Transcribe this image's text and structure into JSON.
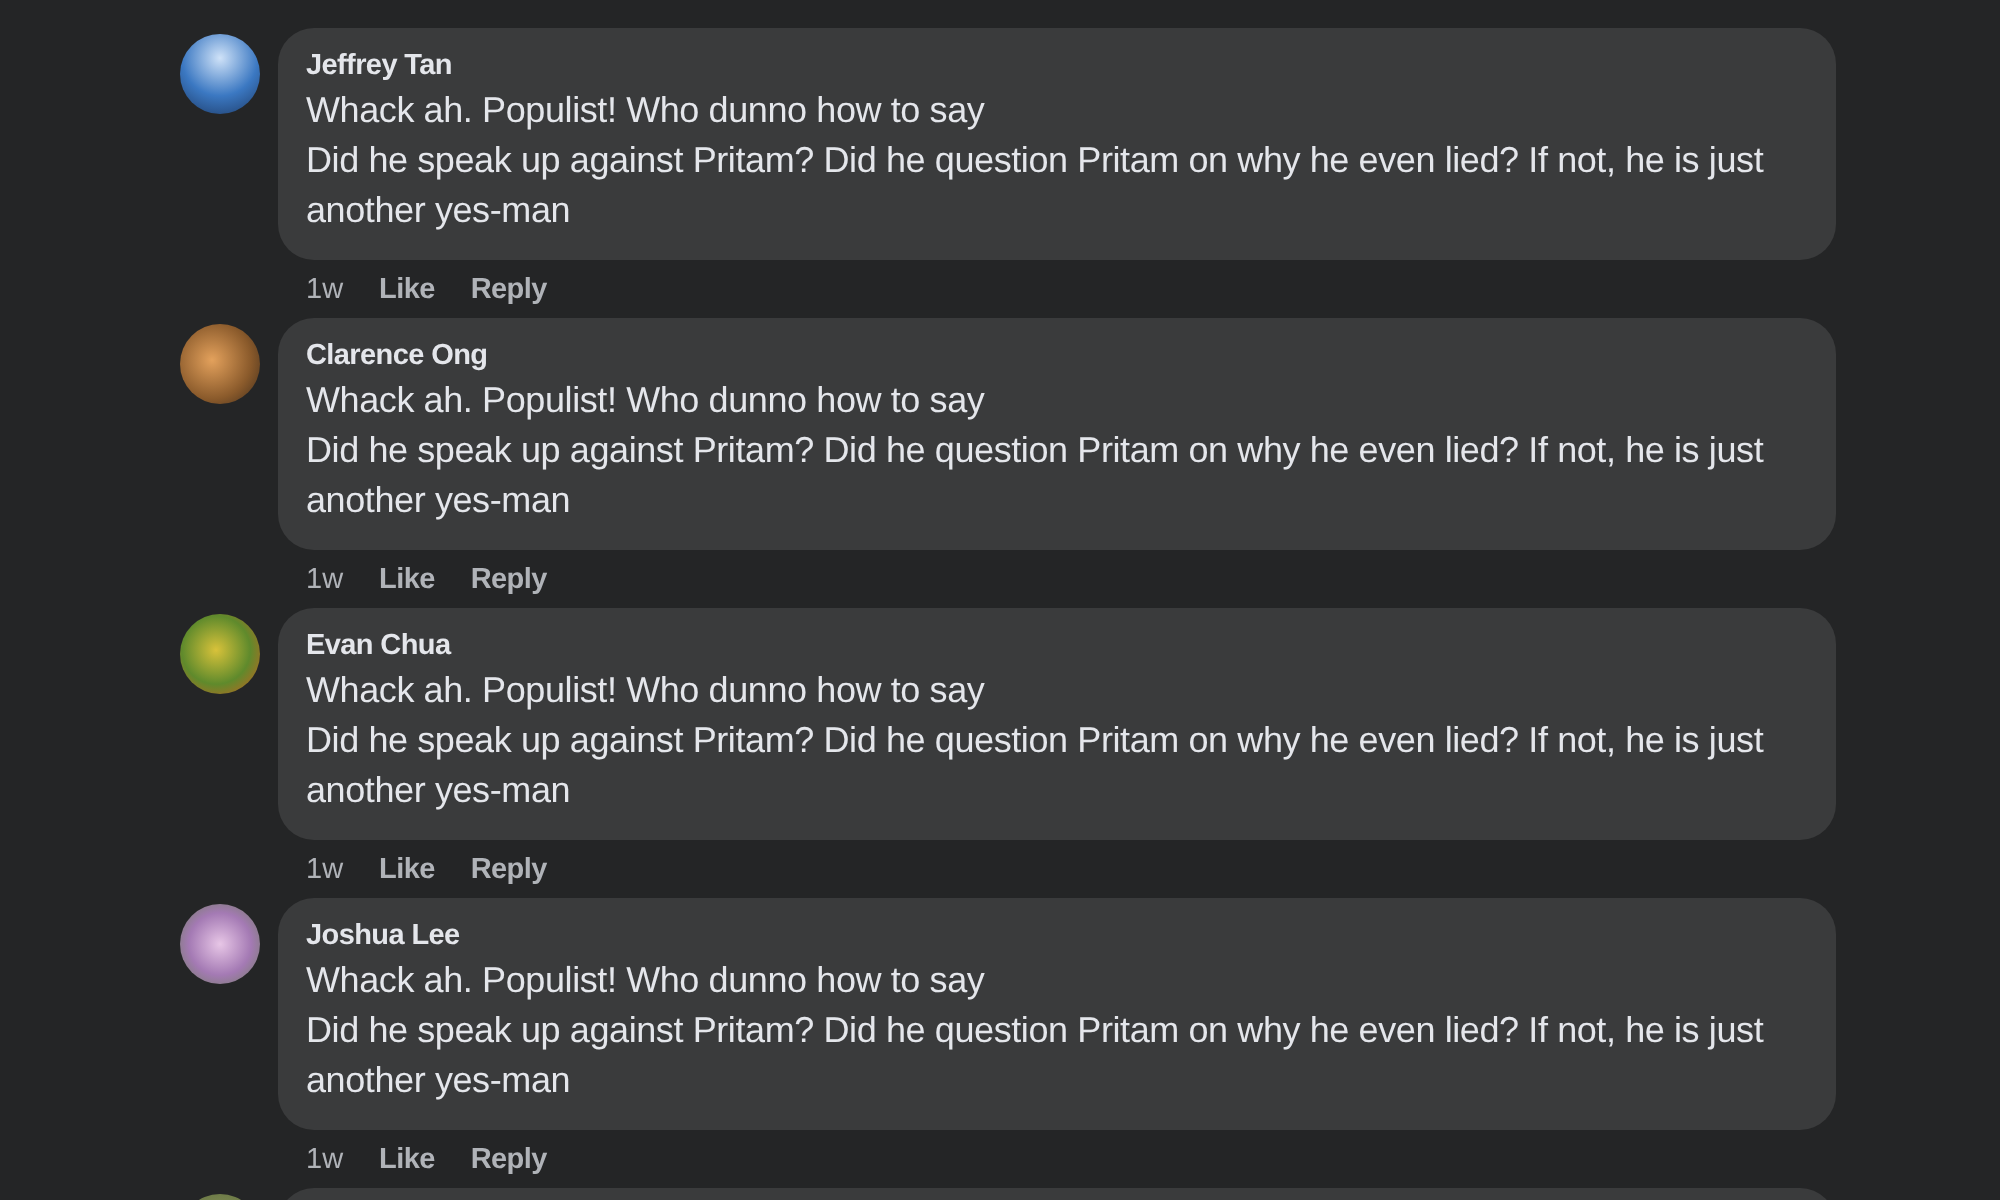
{
  "comments": [
    {
      "author": "Jeffrey Tan",
      "lines": [
        "Whack ah. Populist! Who dunno how to say",
        "Did he speak up against Pritam? Did he question Pritam on why he even lied? If not, he is just another yes-man"
      ],
      "time": "1w",
      "actions": [
        "Like",
        "Reply"
      ]
    },
    {
      "author": "Clarence Ong",
      "lines": [
        "Whack ah. Populist! Who dunno how to say",
        "Did he speak up against Pritam? Did he question Pritam on why he even lied? If not, he is just another yes-man"
      ],
      "time": "1w",
      "actions": [
        "Like",
        "Reply"
      ]
    },
    {
      "author": "Evan Chua",
      "lines": [
        "Whack ah. Populist! Who dunno how to say",
        "Did he speak up against Pritam? Did he question Pritam on why he even lied? If not, he is just another yes-man"
      ],
      "time": "1w",
      "actions": [
        "Like",
        "Reply"
      ]
    },
    {
      "author": "Joshua Lee",
      "lines": [
        "Whack ah. Populist! Who dunno how to say",
        "Did he speak up against Pritam? Did he question Pritam on why he even lied? If not, he is just another yes-man"
      ],
      "time": "1w",
      "actions": [
        "Like",
        "Reply"
      ]
    }
  ]
}
